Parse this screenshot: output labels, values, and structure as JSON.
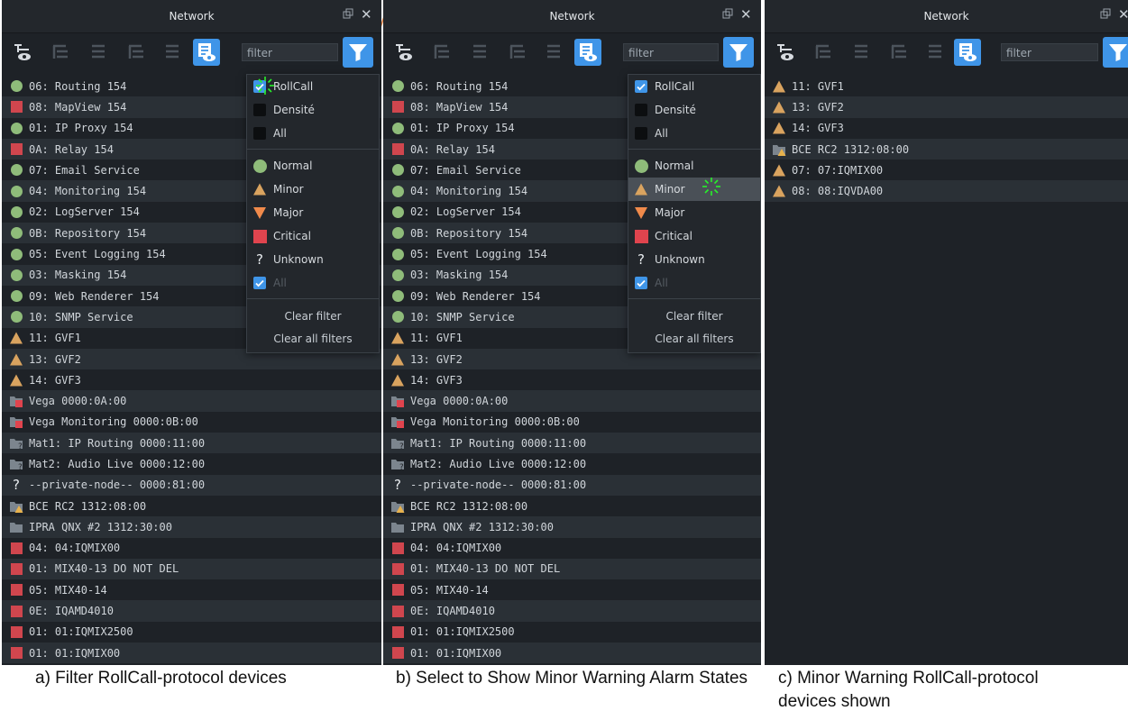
{
  "window_title": "Network",
  "filter_placeholder": "filter",
  "menu": {
    "protocols": [
      "RollCall",
      "Densité",
      "All"
    ],
    "states": [
      "Normal",
      "Minor",
      "Major",
      "Critical",
      "Unknown",
      "All"
    ],
    "actions": [
      "Clear filter",
      "Clear all filters"
    ]
  },
  "device_list": [
    {
      "icon": "green-dot-icon",
      "label": "06: Routing 154"
    },
    {
      "icon": "red-square-icon",
      "label": "08: MapView 154"
    },
    {
      "icon": "green-dot-icon",
      "label": "01: IP Proxy 154"
    },
    {
      "icon": "red-square-icon",
      "label": "0A: Relay 154"
    },
    {
      "icon": "green-dot-icon",
      "label": "07: Email Service"
    },
    {
      "icon": "green-dot-icon",
      "label": "04: Monitoring 154"
    },
    {
      "icon": "green-dot-icon",
      "label": "02: LogServer 154"
    },
    {
      "icon": "green-dot-icon",
      "label": "0B: Repository 154"
    },
    {
      "icon": "green-dot-icon",
      "label": "05: Event Logging 154"
    },
    {
      "icon": "green-dot-icon",
      "label": "03: Masking 154"
    },
    {
      "icon": "green-dot-icon",
      "label": "09: Web Renderer 154"
    },
    {
      "icon": "green-dot-icon",
      "label": "10: SNMP Service"
    },
    {
      "icon": "minor-triangle-icon",
      "label": "11: GVF1"
    },
    {
      "icon": "minor-triangle-icon",
      "label": "13: GVF2"
    },
    {
      "icon": "minor-triangle-icon",
      "label": "14: GVF3"
    },
    {
      "icon": "folder-critical-icon",
      "label": "Vega 0000:0A:00"
    },
    {
      "icon": "folder-critical-icon",
      "label": "Vega Monitoring 0000:0B:00"
    },
    {
      "icon": "folder-unknown-icon",
      "label": "Mat1: IP Routing 0000:11:00"
    },
    {
      "icon": "folder-unknown-icon",
      "label": "Mat2: Audio Live 0000:12:00"
    },
    {
      "icon": "question-icon",
      "label": "--private-node-- 0000:81:00"
    },
    {
      "icon": "folder-minor-icon",
      "label": "BCE RC2 1312:08:00"
    },
    {
      "icon": "folder-grey-icon",
      "label": "IPRA QNX #2 1312:30:00"
    },
    {
      "icon": "red-square-icon",
      "label": "04: 04:IQMIX00"
    },
    {
      "icon": "red-square-icon",
      "label": "01: MIX40-13 DO NOT DEL"
    },
    {
      "icon": "red-square-icon",
      "label": "05: MIX40-14"
    },
    {
      "icon": "red-square-icon",
      "label": "0E: IQAMD4010"
    },
    {
      "icon": "red-square-icon",
      "label": "01: 01:IQMIX2500"
    },
    {
      "icon": "red-square-icon",
      "label": "01: 01:IQMIX00"
    }
  ],
  "filtered_list": [
    {
      "icon": "minor-triangle-icon",
      "label": "11: GVF1"
    },
    {
      "icon": "minor-triangle-icon",
      "label": "13: GVF2"
    },
    {
      "icon": "minor-triangle-icon",
      "label": "14: GVF3"
    },
    {
      "icon": "folder-minor-icon",
      "label": "BCE RC2 1312:08:00"
    },
    {
      "icon": "minor-triangle-icon",
      "label": "07: 07:IQMIX00"
    },
    {
      "icon": "minor-triangle-icon",
      "label": "08: 08:IQVDA00"
    }
  ],
  "captions": [
    "a) Filter RollCall-protocol devices",
    "b) Select to Show Minor Warning Alarm States",
    "c) Minor Warning RollCall-protocol devices shown"
  ],
  "colors": {
    "normal": "#8fbc7a",
    "minor": "#d9a35f",
    "major": "#f08a4b",
    "critical": "#e0444e",
    "accent": "#3f95e8",
    "panel_bg": "#1e2227"
  }
}
